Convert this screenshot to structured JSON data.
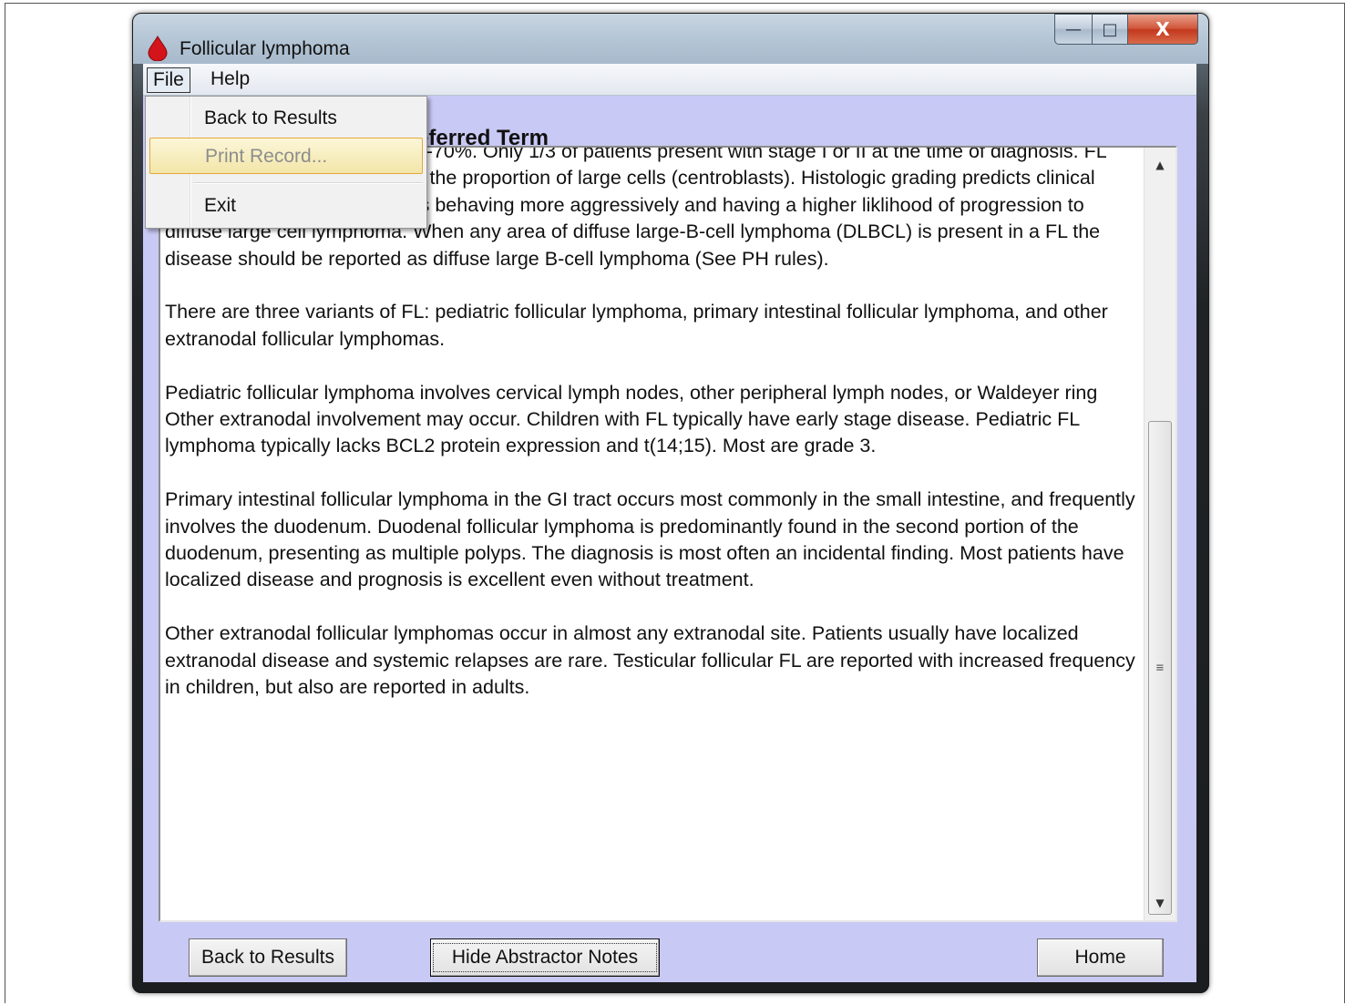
{
  "window": {
    "title": "Follicular lymphoma",
    "caption": {
      "minimize": "—",
      "maximize": "□",
      "close": "X"
    }
  },
  "menubar": {
    "file": "File",
    "help": "Help"
  },
  "file_menu": {
    "items": [
      {
        "label": "Back to Results",
        "enabled": true
      },
      {
        "label": "Print Record...",
        "enabled": false,
        "highlighted": true
      },
      {
        "label": "Exit",
        "enabled": true
      }
    ]
  },
  "section_heading": "eferred Term",
  "content": {
    "paragraphs": [
      "Bone marrow is involved in 40-70%. Only 1/3 of patients present with stage I or II at the time of diagnosis. FL has been graded according to the proportion of large cells (centroblasts). Histologic grading predicts clinical outcome, with more large cells behaving more aggressively and having a higher liklihood of progression to diffuse large cell lymphoma. When any area of diffuse large-B-cell lymphoma (DLBCL) is present in a FL the disease should be reported as diffuse large B-cell lymphoma (See PH rules).",
      "There are three variants of FL: pediatric follicular lymphoma, primary intestinal follicular lymphoma, and other extranodal follicular lymphomas.",
      "Pediatric follicular lymphoma involves cervical lymph nodes, other peripheral lymph nodes, or Waldeyer ring Other extranodal involvement may occur. Children with FL typically have early stage disease. Pediatric FL lymphoma typically lacks BCL2 protein expression and t(14;15). Most are grade 3.",
      "Primary intestinal follicular lymphoma in the GI tract occurs most commonly in the small intestine, and frequently involves the duodenum. Duodenal follicular lymphoma is predominantly found in the second portion of the duodenum, presenting as multiple polyps. The diagnosis is most often an incidental finding. Most patients have localized disease and prognosis is excellent even without treatment.",
      "Other extranodal follicular lymphomas occur in almost any extranodal site. Patients usually have localized extranodal disease and systemic relapses are rare. Testicular follicular FL are reported with increased frequency in children, but also are reported in adults."
    ]
  },
  "buttons": {
    "back": "Back to Results",
    "hide_notes": "Hide Abstractor Notes",
    "home": "Home"
  },
  "scrollbar": {
    "up": "▲",
    "down": "▼",
    "grip": "≡"
  },
  "colors": {
    "client_bg": "#c9c9f5",
    "highlight_border": "#e5a83a",
    "app_icon": "#d3141a"
  }
}
